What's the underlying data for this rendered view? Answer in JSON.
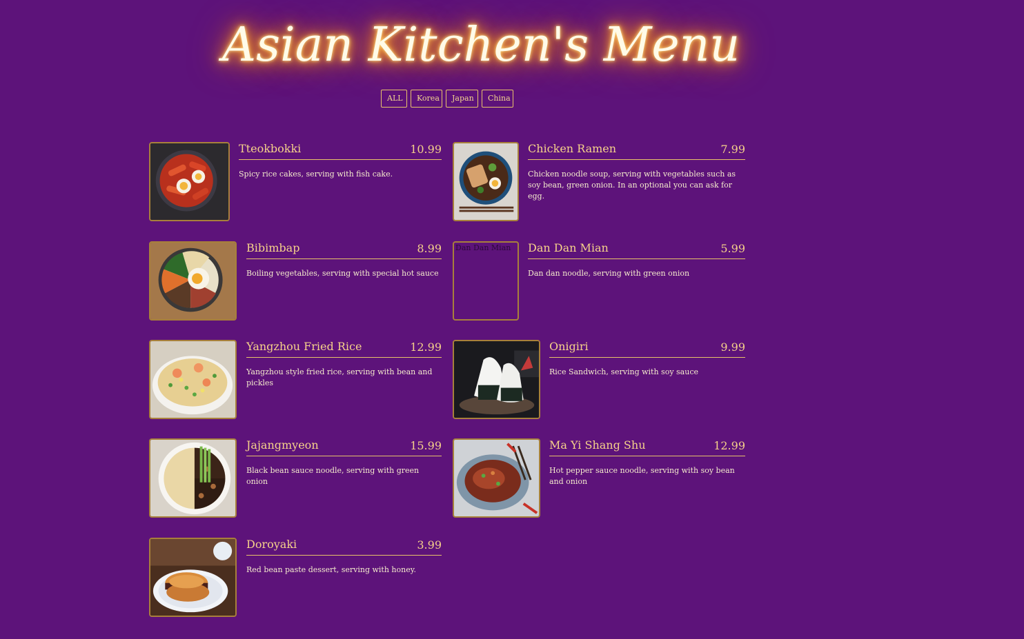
{
  "header": {
    "title": "Asian Kitchen's Menu"
  },
  "filters": [
    "ALL",
    "Korea",
    "Japan",
    "China"
  ],
  "menu": [
    {
      "name": "Tteokbokki",
      "price": "10.99",
      "desc": "Spicy rice cakes, serving with fish cake."
    },
    {
      "name": "Chicken Ramen",
      "price": "7.99",
      "desc": "Chicken noodle soup, serving with vegetables such as soy bean, green onion. In an optional you can ask for egg."
    },
    {
      "name": "Bibimbap",
      "price": "8.99",
      "desc": "Boiling vegetables, serving with special hot sauce"
    },
    {
      "name": "Dan Dan Mian",
      "price": "5.99",
      "desc": "Dan dan noodle, serving with green onion",
      "image_alt": "Dan Dan Mian"
    },
    {
      "name": "Yangzhou Fried Rice",
      "price": "12.99",
      "desc": "Yangzhou style fried rice, serving with bean and pickles"
    },
    {
      "name": "Onigiri",
      "price": "9.99",
      "desc": "Rice Sandwich, serving with soy sauce"
    },
    {
      "name": "Jajangmyeon",
      "price": "15.99",
      "desc": "Black bean sauce noodle, serving with green onion"
    },
    {
      "name": "Ma Yi Shang Shu",
      "price": "12.99",
      "desc": "Hot pepper sauce noodle, serving with soy bean and onion"
    },
    {
      "name": "Doroyaki",
      "price": "3.99",
      "desc": "Red bean paste dessert, serving with honey."
    }
  ],
  "colors": {
    "background": "#5d137a",
    "accent": "#e9c46a",
    "title_glow": "#ff9a1f"
  }
}
